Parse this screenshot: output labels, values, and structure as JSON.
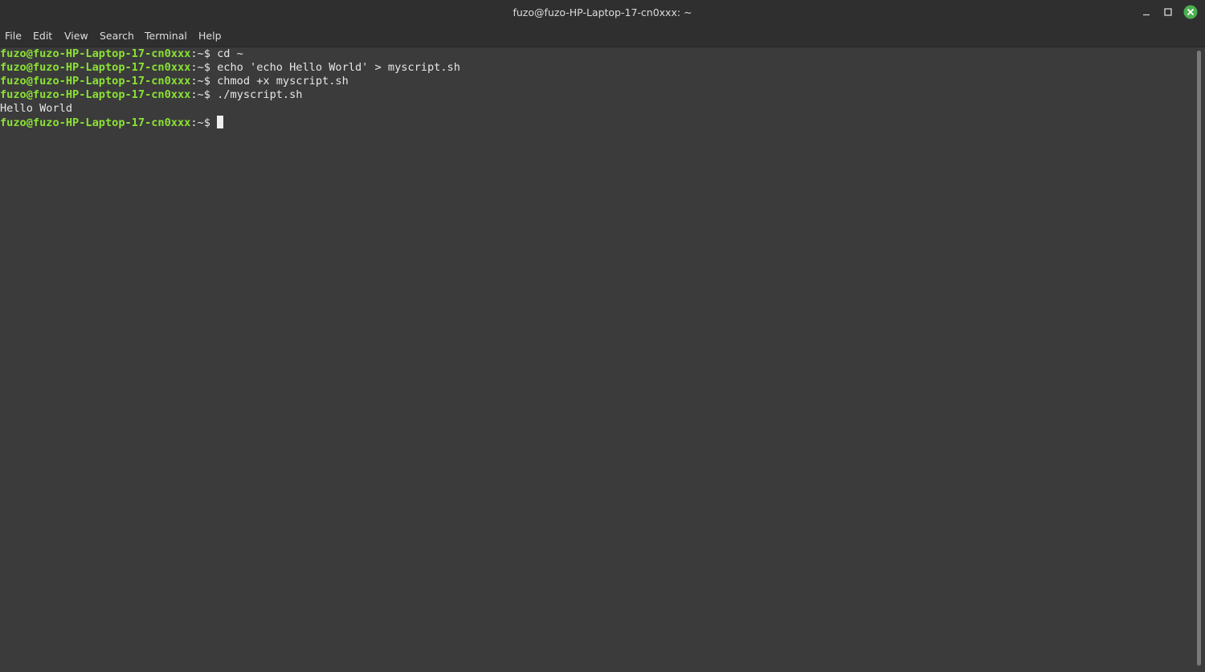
{
  "window": {
    "title": "fuzo@fuzo-HP-Laptop-17-cn0xxx: ~",
    "accent_close": "#4caf50"
  },
  "menu": {
    "file": "File",
    "edit": "Edit",
    "view": "View",
    "search": "Search",
    "terminal": "Terminal",
    "help": "Help"
  },
  "terminal": {
    "prompt_user": "fuzo@fuzo-HP-Laptop-17-cn0xxx",
    "prompt_sep": ":",
    "prompt_path": "~$ ",
    "lines": [
      {
        "type": "command",
        "text": "cd ~"
      },
      {
        "type": "command",
        "text": "echo 'echo Hello World' > myscript.sh"
      },
      {
        "type": "command",
        "text": "chmod +x myscript.sh"
      },
      {
        "type": "command",
        "text": "./myscript.sh"
      },
      {
        "type": "output",
        "text": "Hello World"
      },
      {
        "type": "command",
        "text": ""
      }
    ],
    "colors": {
      "prompt": "#8ae234",
      "text": "#e6e6e6",
      "background": "#3b3b3b"
    }
  }
}
